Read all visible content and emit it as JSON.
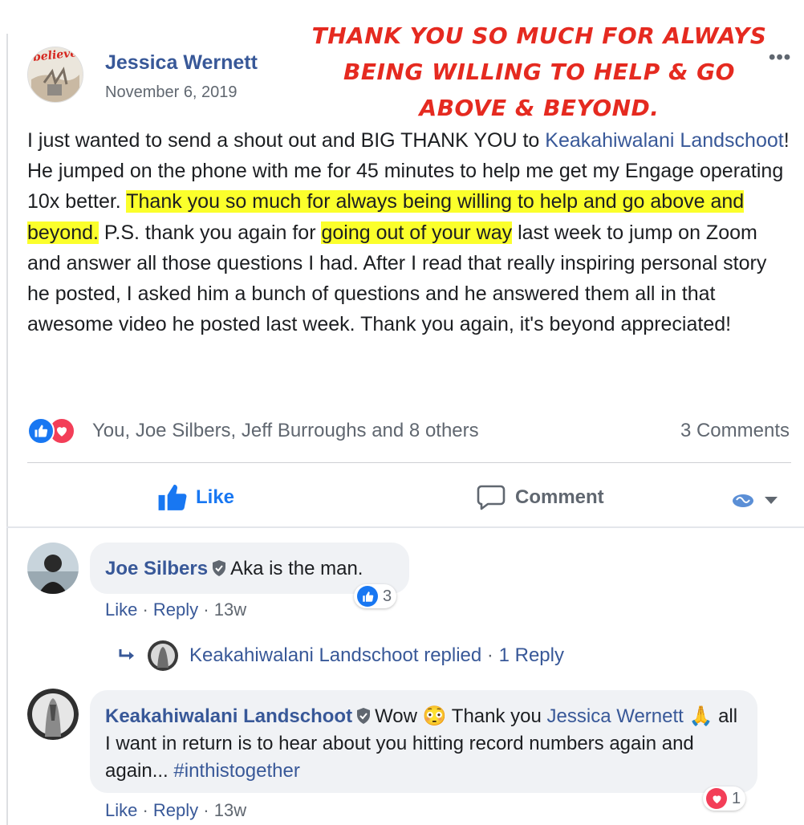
{
  "post": {
    "author": "Jessica Wernett",
    "date": "November 6, 2019",
    "more_label": "•••",
    "avatar_wordmark": "believe",
    "annotation_lines": [
      "THANK YOU SO MUCH FOR ALWAYS",
      "BEING WILLING TO HELP & GO",
      "ABOVE & BEYOND."
    ],
    "body": {
      "p1": "I just wanted to send a shout out and BIG THANK YOU to ",
      "mention": "Keakahiwalani Landschoot",
      "p2": "! He jumped on the phone with me for 45 minutes to help me get my Engage operating 10x better. ",
      "highlight1": "Thank you so much for always being willing to help and go above and beyond.",
      "p3": " P.S. thank you again for ",
      "highlight2": "going out of your way",
      "p4": " last week to jump on Zoom and answer all those questions I had. After I read that really inspiring personal story he posted, I asked him a bunch of questions and he answered them all in that awesome video he posted last week. Thank you again, it's beyond appreciated!"
    },
    "reactions_text": "You, Joe Silbers, Jeff Burroughs and 8 others",
    "comments_count": "3 Comments",
    "actions": {
      "like": "Like",
      "comment": "Comment"
    }
  },
  "comments": [
    {
      "author": "Joe Silbers",
      "text": "Aka is the man.",
      "like": "Like",
      "reply": "Reply",
      "time": "13w",
      "reaction_count": "3",
      "replies_label": "Keakahiwalani Landschoot replied",
      "replies_count": "1 Reply"
    },
    {
      "author": "Keakahiwalani Landschoot",
      "text_a": "Wow",
      "emoji_a": "😳",
      "text_b": "Thank you",
      "mention": "Jessica Wernett",
      "emoji_b": "🙏",
      "text_c": "all I want in return is to hear about you hitting record numbers again and again...",
      "hashtag": "#inthistogether",
      "like": "Like",
      "reply": "Reply",
      "time": "13w",
      "reaction_count": "1"
    }
  ],
  "colors": {
    "link": "#385898",
    "highlight": "#fbff2b",
    "like_blue": "#1877f2",
    "love_red": "#f33e58",
    "annotation_red": "#e52a20"
  }
}
